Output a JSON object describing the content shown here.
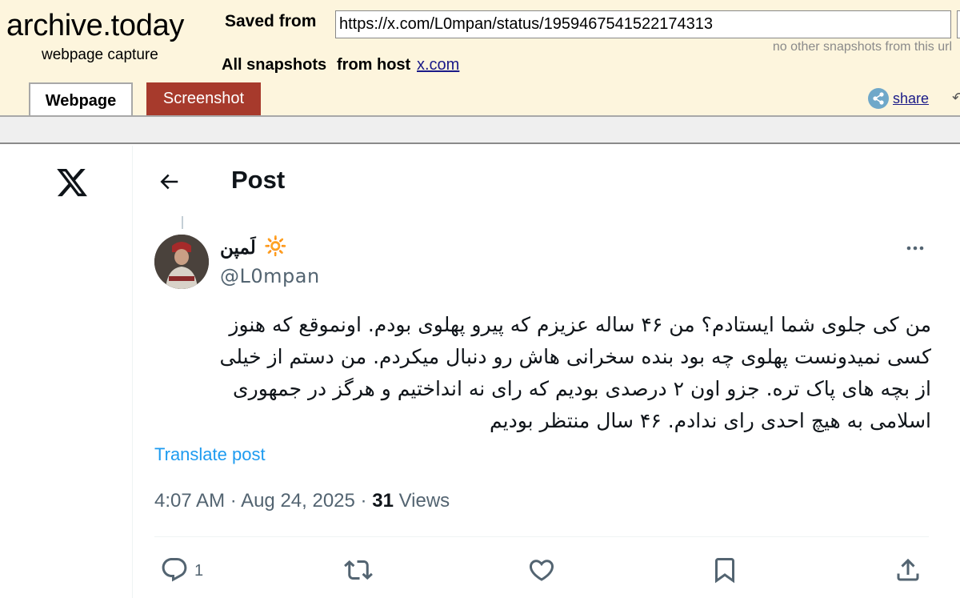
{
  "archive": {
    "logo_title": "archive.today",
    "logo_subtitle": "webpage capture",
    "saved_from_label": "Saved from",
    "url_value": "https://x.com/L0mpan/status/1959467541522174313",
    "no_snapshots_text": "no other snapshots from this url",
    "all_snapshots_label": "All snapshots",
    "from_host_label": "from host",
    "host_link": "x.com",
    "tabs": [
      {
        "label": "Webpage",
        "active": true
      },
      {
        "label": "Screenshot",
        "active": false
      }
    ],
    "share_label": "share"
  },
  "post_page": {
    "header_title": "Post",
    "author": {
      "display_name": "لَمپن",
      "status_emoji": "🔆",
      "handle": "@L0mpan"
    },
    "text_lines": [
      "من کی جلوی شما ایستادم؟ من ۴۶ ساله عزیزم که پیرو پهلوی بودم. اونموقع که هنوز",
      "کسی نمیدونست پهلوی چه بود بنده سخرانی هاش رو دنبال میکردم. من دستم از خیلی",
      "از بچه های پاک تره. جزو اون ۲ درصدی بودیم که رای نه انداختیم و هرگز در جمهوری",
      "اسلامی به هیچ احدی رای ندادم. ۴۶ سال منتظر بودیم"
    ],
    "translate_label": "Translate post",
    "time": "4:07 AM",
    "date": "Aug 24, 2025",
    "separator": "·",
    "views_count": "31",
    "views_label": "Views",
    "reply_count": "1",
    "colors": {
      "link_blue": "#1d9bf0",
      "secondary_text": "#536471",
      "primary_text": "#0f1419",
      "archive_bg": "#fdf5dd",
      "screenshot_tab": "#a73a2c"
    },
    "icons": {
      "logo": "x-logo-icon",
      "back": "arrow-left-icon",
      "more": "more-dots-icon",
      "reply": "reply-bubble-icon",
      "repost": "repost-icon",
      "like": "heart-icon",
      "bookmark": "bookmark-icon",
      "share": "upload-share-icon"
    }
  }
}
